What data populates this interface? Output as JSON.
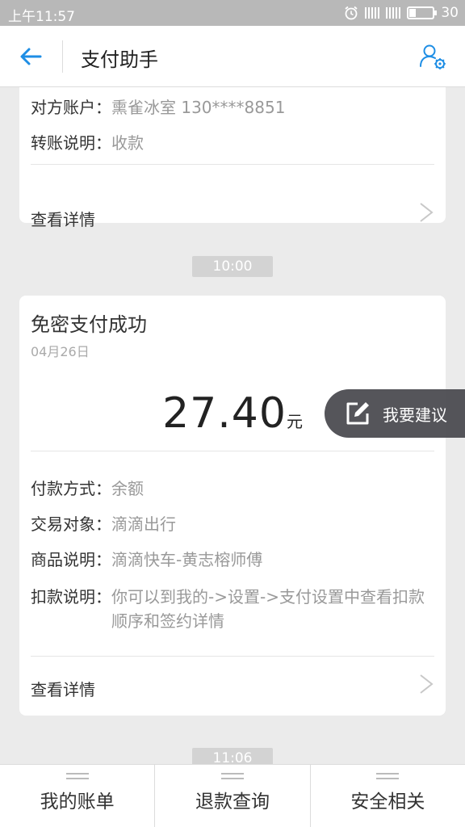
{
  "status_bar": {
    "time": "上午11:57",
    "battery": "30"
  },
  "header": {
    "title": "支付助手"
  },
  "card1": {
    "rows": [
      {
        "key": "对方账户：",
        "value": "熏雀冰室 130****8851"
      },
      {
        "key": "转账说明：",
        "value": "收款"
      }
    ],
    "detail_label": "查看详情"
  },
  "time_labels": [
    "10:00",
    "11:06"
  ],
  "card2": {
    "title": "免密支付成功",
    "date": "04月26日",
    "amount": "27.40",
    "unit": "元",
    "rows": [
      {
        "key": "付款方式：",
        "value": "余额"
      },
      {
        "key": "交易对象：",
        "value": "滴滴出行"
      },
      {
        "key": "商品说明：",
        "value": "滴滴快车-黄志榕师傅"
      },
      {
        "key": "扣款说明：",
        "value": "你可以到我的->设置->支付设置中查看扣款顺序和签约详情"
      }
    ],
    "detail_label": "查看详情"
  },
  "feedback_button": {
    "label": "我要建议"
  },
  "bottom_nav": [
    {
      "label": "我的账单"
    },
    {
      "label": "退款查询"
    },
    {
      "label": "安全相关"
    }
  ],
  "colors": {
    "accent": "#1e8ee5",
    "background": "#ebebeb"
  },
  "icons": [
    "back-arrow-icon",
    "user-settings-icon",
    "chevron-right-icon",
    "edit-icon",
    "alarm-icon"
  ]
}
